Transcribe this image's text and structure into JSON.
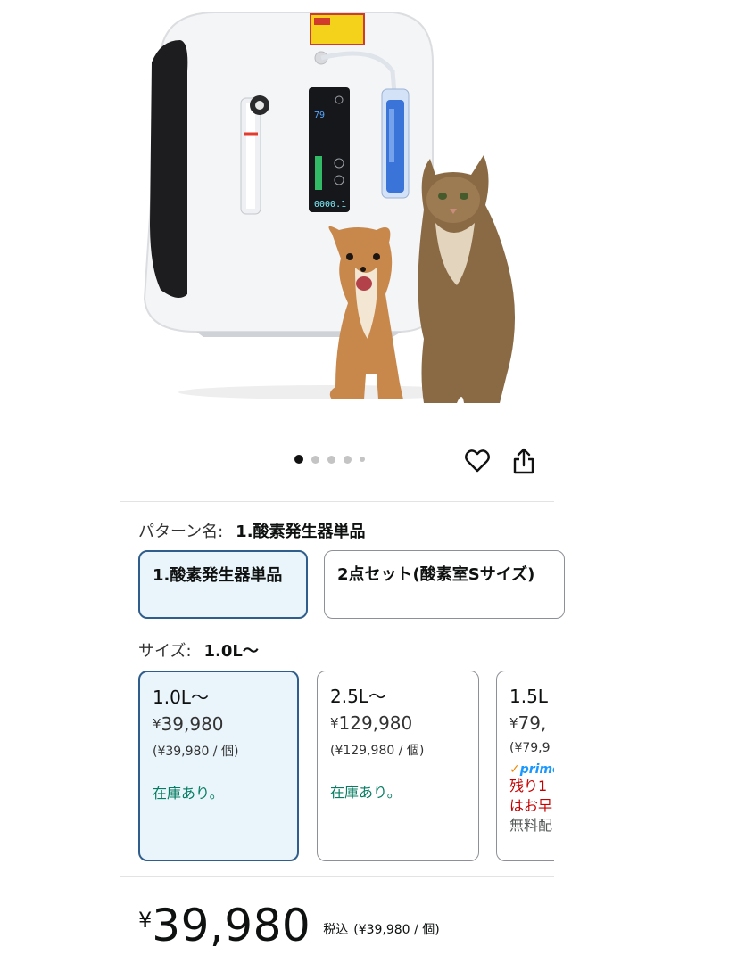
{
  "product": {
    "image_alt": "",
    "concentrator_display": "0000.1",
    "screen_value": "79"
  },
  "carousel": {
    "total": 5,
    "active": 0
  },
  "icons": {
    "favorite": "heart-icon",
    "share": "share-icon"
  },
  "pattern": {
    "label": "パターン名:",
    "selected": "1.酸素発生器単品",
    "options": [
      {
        "label": "1.酸素発生器単品",
        "selected": true
      },
      {
        "label": "2点セット(酸素室Sサイズ)",
        "selected": false
      }
    ]
  },
  "size": {
    "label": "サイズ:",
    "selected": "1.0L〜",
    "options": [
      {
        "size": "1.0L〜",
        "yen": "¥",
        "price": "39,980",
        "unit": "(¥39,980 / 個)",
        "stock": "在庫あり。",
        "selected": true
      },
      {
        "size": "2.5L〜",
        "yen": "¥",
        "price": "129,980",
        "unit": "(¥129,980 / 個)",
        "stock": "在庫あり。",
        "selected": false
      },
      {
        "size": "1.5L",
        "yen": "¥",
        "price": "79,",
        "unit": "(¥79,9",
        "prime": "prime",
        "low_stock_1": "残り1",
        "low_stock_2": "はお早",
        "shipping": "無料配",
        "selected": false
      }
    ]
  },
  "price": {
    "yen": "¥",
    "amount": "39,980",
    "tax": "税込",
    "unit": "(¥39,980 / 個)"
  },
  "colors": {
    "accent": "#2f5e8c",
    "selected_bg": "#eaf5fb",
    "stock": "#067d62",
    "low_stock": "#c40000",
    "prime": "#1a98ff"
  }
}
